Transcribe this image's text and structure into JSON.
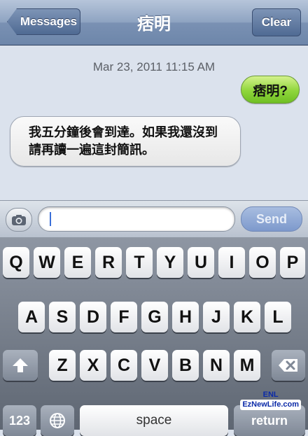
{
  "navbar": {
    "back_label": "Messages",
    "title": "痞明",
    "clear_label": "Clear"
  },
  "conversation": {
    "timestamp": "Mar 23, 2011 11:15 AM",
    "outgoing": "痞明?",
    "incoming_line1": "我五分鐘後會到達。如果我還沒到",
    "incoming_line2": "請再讀一遍這封簡訊。"
  },
  "input": {
    "text": "",
    "send_label": "Send",
    "camera_icon": "camera-icon"
  },
  "keyboard": {
    "row1": [
      "Q",
      "W",
      "E",
      "R",
      "T",
      "Y",
      "U",
      "I",
      "O",
      "P"
    ],
    "row2": [
      "A",
      "S",
      "D",
      "F",
      "G",
      "H",
      "J",
      "K",
      "L"
    ],
    "row3": [
      "Z",
      "X",
      "C",
      "V",
      "B",
      "N",
      "M"
    ],
    "numbers_label": "123",
    "space_label": "space",
    "return_label": "return",
    "shift_icon": "shift-icon",
    "globe_icon": "globe-icon",
    "delete_icon": "delete-icon"
  },
  "watermark": {
    "line1": "ENL",
    "line2": "EzNewLife.com"
  },
  "colors": {
    "outgoing_bubble": "#8fd63b",
    "incoming_bubble": "#eeeeee",
    "nav": "#7a91b3"
  }
}
